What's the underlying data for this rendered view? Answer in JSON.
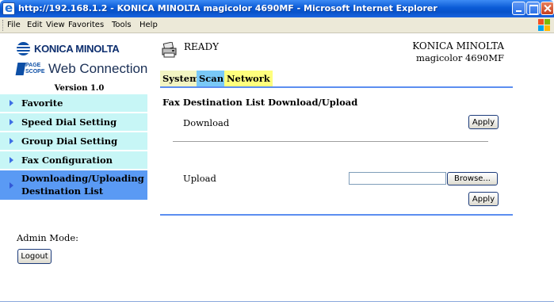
{
  "window": {
    "title": "http://192.168.1.2 - KONICA MINOLTA magicolor 4690MF - Microsoft Internet Explorer"
  },
  "menubar": {
    "items": [
      "File",
      "Edit",
      "View",
      "Favorites",
      "Tools",
      "Help"
    ]
  },
  "sidebar": {
    "logo_text": "KONICA MINOLTA",
    "pagescope_text": "PAGE SCOPE",
    "product_text": "Web Connection",
    "version": "Version 1.0",
    "items": [
      {
        "label": "Favorite",
        "active": false
      },
      {
        "label": "Speed Dial Setting",
        "active": false
      },
      {
        "label": "Group Dial Setting",
        "active": false
      },
      {
        "label": "Fax Configuration",
        "active": false
      },
      {
        "label_line1": "Downloading/Uploading",
        "label_line2": "Destination List",
        "active": true
      }
    ],
    "admin_label": "Admin Mode:",
    "logout_label": "Logout"
  },
  "header": {
    "status": "READY",
    "brand": "KONICA MINOLTA",
    "model": "magicolor 4690MF",
    "tabs": [
      {
        "label": "System",
        "color": "#f3f5c3"
      },
      {
        "label": "Scan",
        "color": "#79c9f7"
      },
      {
        "label": "Network",
        "color": "#ffff7d"
      }
    ]
  },
  "main": {
    "section_title": "Fax Destination List Download/Upload",
    "download_label": "Download",
    "download_button": "Apply",
    "upload_label": "Upload",
    "upload_value": "",
    "browse_button": "Browse...",
    "upload_button": "Apply"
  },
  "colors": {
    "nav_bg": "#c7f6f6",
    "nav_active_bg": "#5a9af4",
    "divider_blue": "#5c8ef0",
    "titlebar_blue": "#0a5ad6"
  }
}
